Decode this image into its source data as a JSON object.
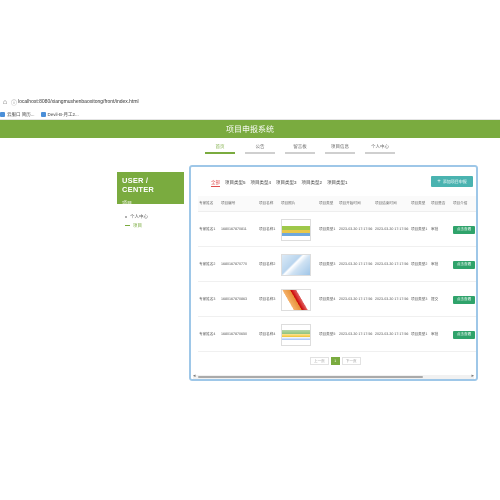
{
  "browser": {
    "url": "localhost:8080/xiangmushenbaoxitong/front/index.html",
    "url_bold_part": "localhost",
    "bookmarks": [
      "云服口 简历...",
      "Devil-B-月工2..."
    ]
  },
  "header": {
    "title": "项目申报系统"
  },
  "nav": {
    "items": [
      {
        "label": "首页",
        "active": true
      },
      {
        "label": "公告",
        "active": false
      },
      {
        "label": "留言板",
        "active": false
      },
      {
        "label": "项目信息",
        "active": false
      },
      {
        "label": "个人中心",
        "active": false
      }
    ]
  },
  "sidebar": {
    "card_title": "USER / CENTER",
    "card_subtitle": "项目",
    "links": [
      {
        "label": "个人中心",
        "active": false
      },
      {
        "label": "项目",
        "active": true
      }
    ]
  },
  "filter_tabs": [
    {
      "label": "全部",
      "active": true
    },
    {
      "label": "项目类型5",
      "active": false
    },
    {
      "label": "项目类型4",
      "active": false
    },
    {
      "label": "项目类型3",
      "active": false
    },
    {
      "label": "项目类型2",
      "active": false
    },
    {
      "label": "项目类型1",
      "active": false
    }
  ],
  "add_button": {
    "label": "添加项目申报"
  },
  "table": {
    "headers": [
      "专家姓名",
      "项目编号",
      "项目名称",
      "项目照片",
      "项目类型",
      "项目开始时间",
      "项目结束时间",
      "项目类型",
      "项目是否",
      "项目介绍"
    ],
    "rows": [
      {
        "expert": "专家姓名1",
        "code": "1680167870811",
        "name": "项目名称1",
        "type": "项目类型1",
        "start": "2023-03-30 17:17:56",
        "end": "2023-03-30 17:17:56",
        "type2": "项目类型1",
        "status": "审批"
      },
      {
        "expert": "专家姓名2",
        "code": "1680167870770",
        "name": "项目名称2",
        "type": "项目类型3",
        "start": "2023-03-30 17:17:56",
        "end": "2023-03-30 17:17:56",
        "type2": "项目类型2",
        "status": "审批"
      },
      {
        "expert": "专家姓名3",
        "code": "1680167870863",
        "name": "项目名称3",
        "type": "项目类型4",
        "start": "2023-03-30 17:17:56",
        "end": "2023-03-30 17:17:56",
        "type2": "项目类型3",
        "status": "提交"
      },
      {
        "expert": "专家姓名4",
        "code": "1680167870650",
        "name": "项目名称4",
        "type": "项目类型5",
        "start": "2023-03-30 17:17:56",
        "end": "2023-03-30 17:17:56",
        "type2": "项目类型1",
        "status": "审批"
      }
    ],
    "action_label": "点击查看"
  },
  "pager": {
    "prev": "上一页",
    "current": "1",
    "next": "下一页"
  },
  "colors": {
    "brand_green": "#7aab3f",
    "action_green": "#2fa36b",
    "add_teal": "#4ab3b0",
    "panel_border": "#9ec7e8",
    "active_tab_red": "#e05050"
  }
}
